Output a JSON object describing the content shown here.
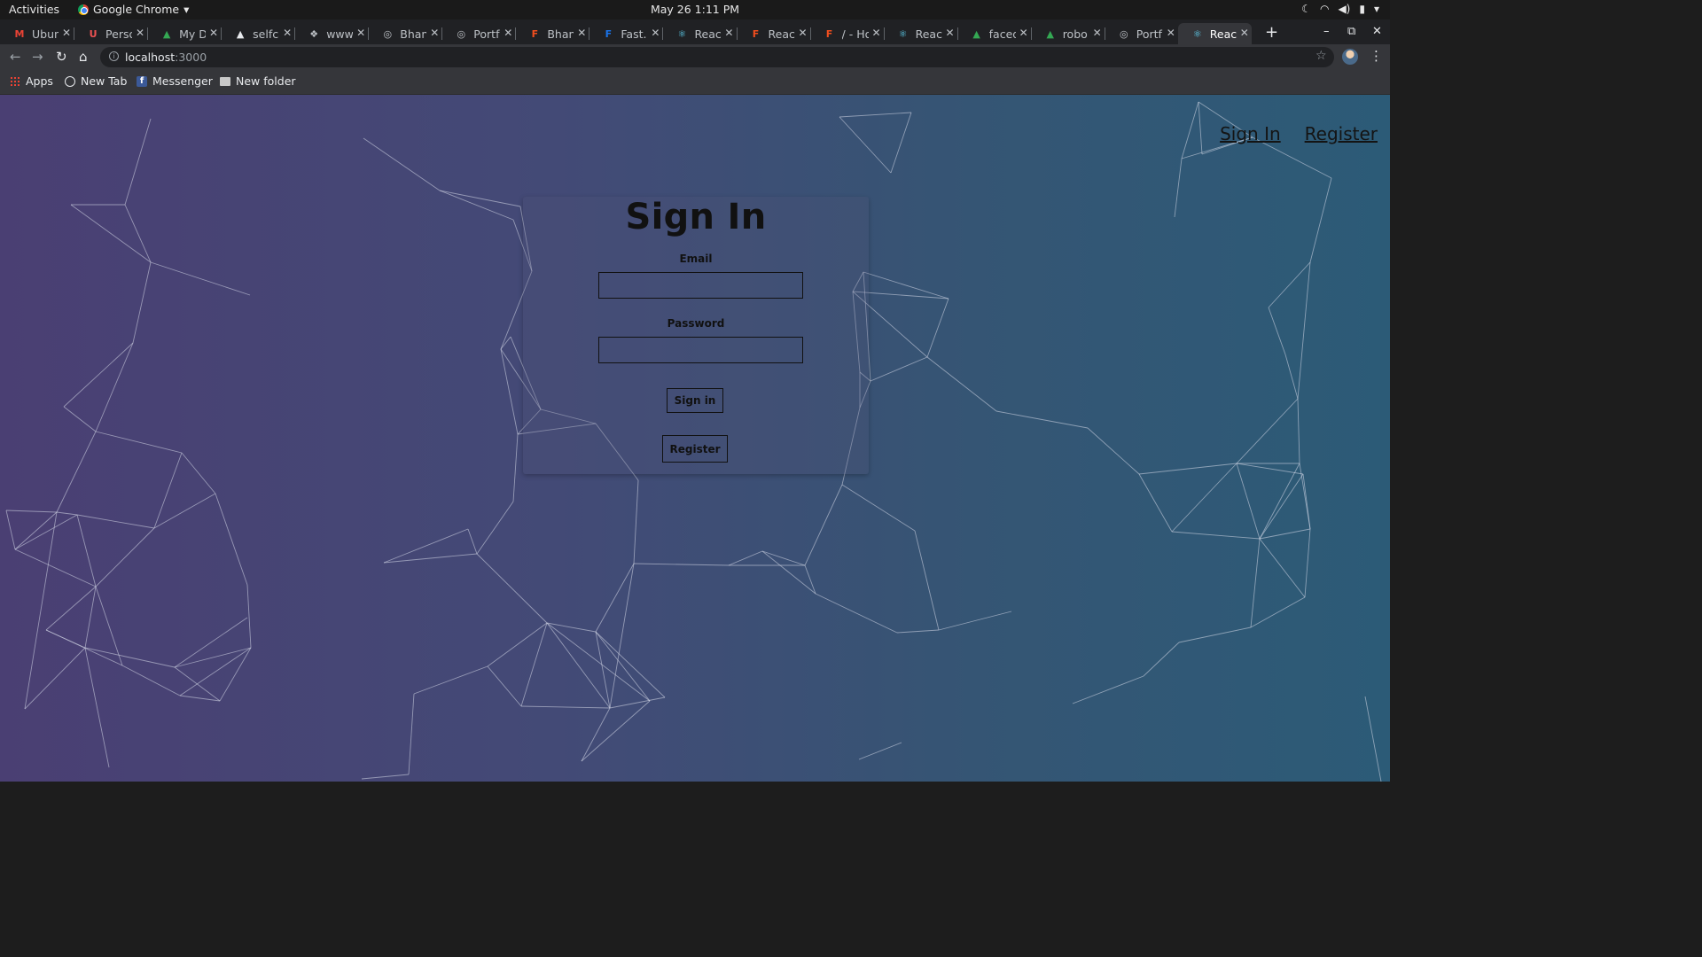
{
  "system": {
    "activities": "Activities",
    "app_name": "Google Chrome",
    "clock": "May 26  1:11 PM"
  },
  "tabs": [
    {
      "title": "Ubuntu",
      "icon": "gmail-icon",
      "color": "#ea4335",
      "glyph": "M"
    },
    {
      "title": "Perso",
      "icon": "udemy-icon",
      "color": "#ec5252",
      "glyph": "U"
    },
    {
      "title": "My Dr",
      "icon": "google-drive-icon",
      "color": "#34a853",
      "glyph": "▲"
    },
    {
      "title": "selfca",
      "icon": "vercel-icon",
      "color": "#e8eaed",
      "glyph": "▲"
    },
    {
      "title": "www",
      "icon": "dropbox-icon",
      "color": "#bdc1c6",
      "glyph": "❖"
    },
    {
      "title": "Bhan",
      "icon": "globe-icon",
      "color": "#bdc1c6",
      "glyph": "◎"
    },
    {
      "title": "Portf",
      "icon": "globe-icon",
      "color": "#bdc1c6",
      "glyph": "◎"
    },
    {
      "title": "Bhan",
      "icon": "figma-icon",
      "color": "#f24e1e",
      "glyph": "F"
    },
    {
      "title": "Fast.i",
      "icon": "fast-icon",
      "color": "#1a73e8",
      "glyph": "F"
    },
    {
      "title": "React",
      "icon": "react-icon",
      "color": "#61dafb",
      "glyph": "⚛"
    },
    {
      "title": "React",
      "icon": "figma-icon",
      "color": "#f24e1e",
      "glyph": "F"
    },
    {
      "title": "/ - Ho",
      "icon": "figma-icon",
      "color": "#f24e1e",
      "glyph": "F"
    },
    {
      "title": "React",
      "icon": "react-icon",
      "color": "#61dafb",
      "glyph": "⚛"
    },
    {
      "title": "faced",
      "icon": "google-drive-icon",
      "color": "#34a853",
      "glyph": "▲"
    },
    {
      "title": "robo",
      "icon": "google-drive-icon",
      "color": "#34a853",
      "glyph": "▲"
    },
    {
      "title": "Portf",
      "icon": "globe-icon",
      "color": "#bdc1c6",
      "glyph": "◎"
    },
    {
      "title": "React",
      "icon": "react-icon",
      "color": "#61dafb",
      "glyph": "⚛",
      "active": true
    }
  ],
  "address": {
    "host": "localhost",
    "port": ":3000"
  },
  "bookmarks": {
    "apps": "Apps",
    "new_tab": "New Tab",
    "messenger": "Messenger",
    "new_folder": "New folder"
  },
  "nav": {
    "signin": "Sign In",
    "register": "Register"
  },
  "form": {
    "title": "Sign In",
    "email_label": "Email",
    "email_value": "",
    "password_label": "Password",
    "password_value": "",
    "signin_button": "Sign in",
    "register_button": "Register"
  }
}
